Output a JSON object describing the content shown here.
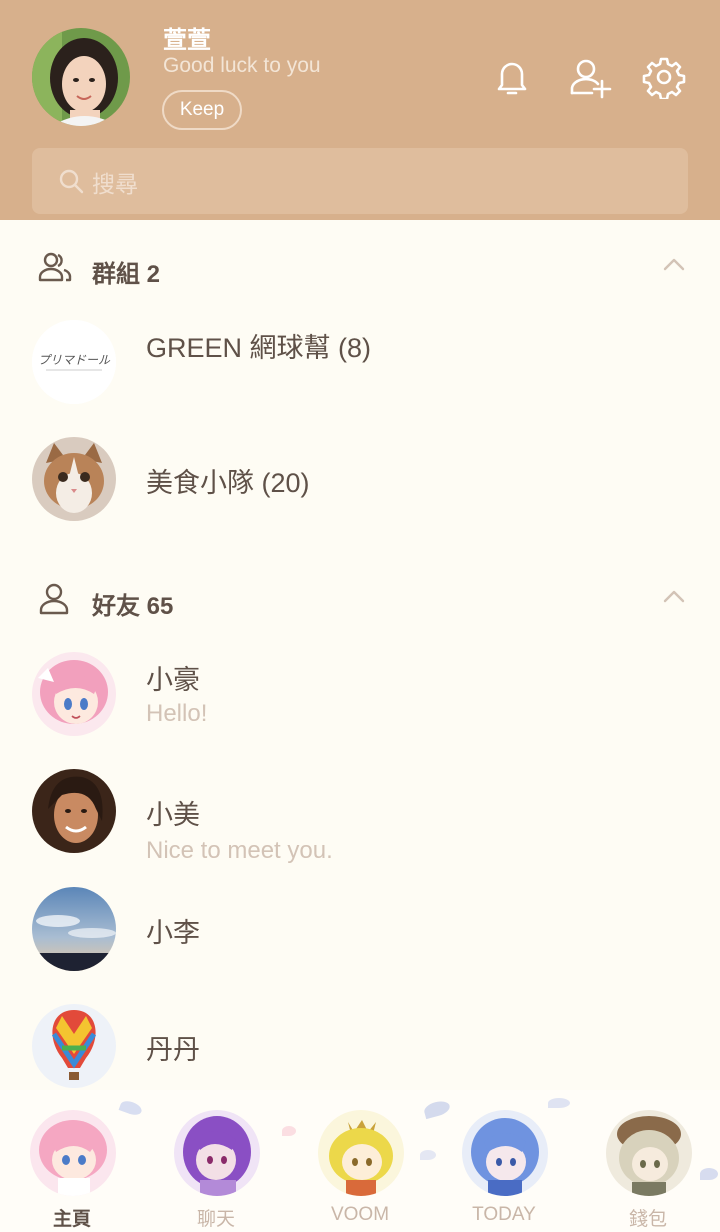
{
  "profile": {
    "name": "萱萱",
    "status": "Good luck to you",
    "keep_label": "Keep"
  },
  "header_icons": [
    "bell-icon",
    "add-friend-icon",
    "gear-icon"
  ],
  "search": {
    "placeholder": "搜尋"
  },
  "groups": {
    "title": "群組 2",
    "items": [
      {
        "name": "GREEN 網球幫 (8)",
        "logo_text": "プリマドール"
      },
      {
        "name": "美食小隊 (20)"
      }
    ]
  },
  "friends": {
    "title": "好友 65",
    "items": [
      {
        "name": "小豪",
        "status": "Hello!"
      },
      {
        "name": "小美",
        "status": "Nice to meet you."
      },
      {
        "name": "小李",
        "status": ""
      },
      {
        "name": "丹丹",
        "status": ""
      }
    ]
  },
  "tabs": [
    {
      "label": "主頁",
      "active": true
    },
    {
      "label": "聊天",
      "active": false
    },
    {
      "label": "VOOM",
      "active": false
    },
    {
      "label": "TODAY",
      "active": false
    },
    {
      "label": "錢包",
      "active": false
    }
  ],
  "colors": {
    "header_bg": "#d7b08c",
    "page_bg": "#fefcf4",
    "text_primary": "#5f5148",
    "text_secondary": "#d3c3b6"
  }
}
